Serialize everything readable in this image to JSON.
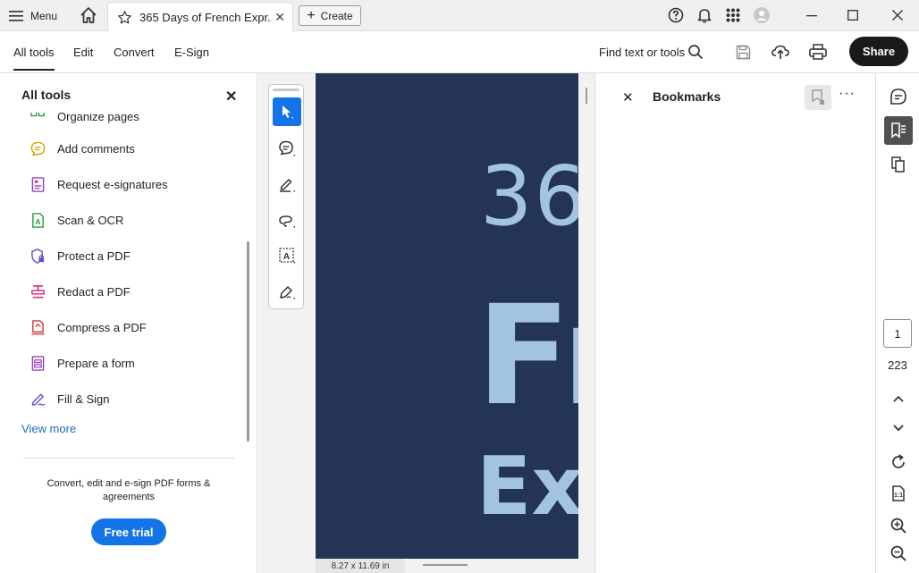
{
  "titlebar": {
    "menu_label": "Menu",
    "tab_title": "365 Days of French Expr...",
    "create_label": "Create"
  },
  "menubar": {
    "tabs": [
      "All tools",
      "Edit",
      "Convert",
      "E-Sign"
    ],
    "active_tab": "All tools",
    "find_label": "Find text or tools",
    "share_label": "Share"
  },
  "left_panel": {
    "title": "All tools",
    "partial_item": "Organize pages",
    "items": [
      {
        "label": "Add comments",
        "icon": "comment-icon",
        "color": "#d6a400"
      },
      {
        "label": "Request e-signatures",
        "icon": "request-signature-icon",
        "color": "#9b3ec1"
      },
      {
        "label": "Scan & OCR",
        "icon": "scan-ocr-icon",
        "color": "#2d9d3a"
      },
      {
        "label": "Protect a PDF",
        "icon": "protect-shield-icon",
        "color": "#6a4bc9"
      },
      {
        "label": "Redact a PDF",
        "icon": "redact-icon",
        "color": "#d4257a"
      },
      {
        "label": "Compress a PDF",
        "icon": "compress-pdf-icon",
        "color": "#d7373f"
      },
      {
        "label": "Prepare a form",
        "icon": "prepare-form-icon",
        "color": "#9b3ec1"
      },
      {
        "label": "Fill & Sign",
        "icon": "fill-sign-icon",
        "color": "#6a4bc9"
      }
    ],
    "view_more": "View more",
    "promo_text": "Convert, edit and e-sign PDF forms & agreements",
    "trial_label": "Free trial"
  },
  "document": {
    "line1": "36",
    "line2": "Fr",
    "line3": "Ex",
    "page_size": "8.27 x 11.69 in",
    "page_color": "#243457",
    "text_color": "#a3c3e3"
  },
  "bookmarks": {
    "title": "Bookmarks"
  },
  "navigation": {
    "current_page": "1",
    "total_pages": "223"
  },
  "colors": {
    "accent": "#1473e6",
    "share_bg": "#1a1a1a"
  }
}
